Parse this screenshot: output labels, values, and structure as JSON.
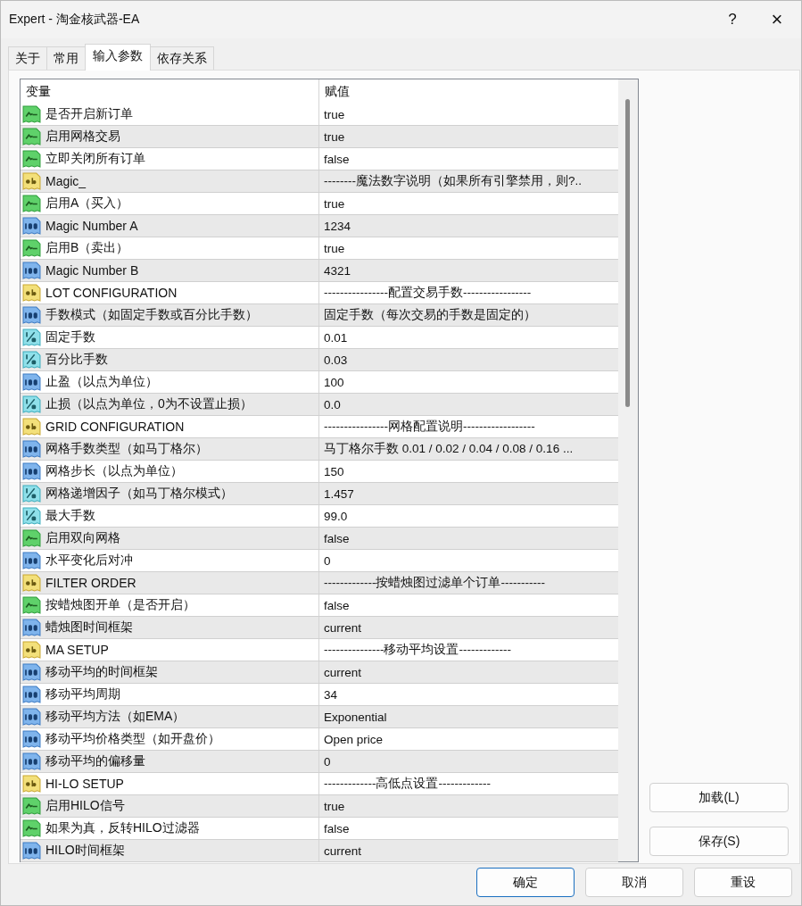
{
  "window": {
    "title": "Expert - 淘金核武器-EA",
    "help": "?",
    "close": "×"
  },
  "tabs": [
    {
      "label": "关于",
      "selected": false
    },
    {
      "label": "常用",
      "selected": false
    },
    {
      "label": "输入参数",
      "selected": true
    },
    {
      "label": "依存关系",
      "selected": false
    }
  ],
  "table": {
    "columns": [
      "变量",
      "赋值"
    ],
    "rows": [
      {
        "kind": "bool",
        "name": "是否开启新订单",
        "value": "true"
      },
      {
        "kind": "bool",
        "name": "启用网格交易",
        "value": "true"
      },
      {
        "kind": "bool",
        "name": "立即关闭所有订单",
        "value": "false"
      },
      {
        "kind": "string",
        "name": "Magic_",
        "value": "--------魔法数字说明（如果所有引擎禁用，则?.."
      },
      {
        "kind": "bool",
        "name": "启用A（买入）",
        "value": "true"
      },
      {
        "kind": "int",
        "name": "Magic Number  A",
        "value": "1234"
      },
      {
        "kind": "bool",
        "name": "启用B（卖出）",
        "value": "true"
      },
      {
        "kind": "int",
        "name": "Magic Number  B",
        "value": "4321"
      },
      {
        "kind": "string",
        "name": "LOT CONFIGURATION",
        "value": "----------------配置交易手数-----------------"
      },
      {
        "kind": "int",
        "name": "手数模式（如固定手数或百分比手数）",
        "value": "固定手数（每次交易的手数是固定的）"
      },
      {
        "kind": "double",
        "name": "固定手数",
        "value": "0.01"
      },
      {
        "kind": "double",
        "name": "百分比手数",
        "value": "0.03"
      },
      {
        "kind": "int",
        "name": "止盈（以点为单位）",
        "value": "100"
      },
      {
        "kind": "double",
        "name": "止损（以点为单位，0为不设置止损）",
        "value": "0.0"
      },
      {
        "kind": "string",
        "name": "GRID CONFIGURATION",
        "value": "----------------网格配置说明------------------"
      },
      {
        "kind": "int",
        "name": "网格手数类型（如马丁格尔）",
        "value": "马丁格尔手数  0.01 / 0.02 / 0.04 / 0.08 / 0.16 ..."
      },
      {
        "kind": "int",
        "name": "网格步长（以点为单位）",
        "value": "150"
      },
      {
        "kind": "double",
        "name": "网格递增因子（如马丁格尔模式）",
        "value": "1.457"
      },
      {
        "kind": "double",
        "name": "最大手数",
        "value": "99.0"
      },
      {
        "kind": "bool",
        "name": "启用双向网格",
        "value": "false"
      },
      {
        "kind": "int",
        "name": "水平变化后对冲",
        "value": "0"
      },
      {
        "kind": "string",
        "name": "FILTER ORDER",
        "value": "-------------按蜡烛图过滤单个订单-----------"
      },
      {
        "kind": "bool",
        "name": "按蜡烛图开单（是否开启）",
        "value": "false"
      },
      {
        "kind": "int",
        "name": "蜡烛图时间框架",
        "value": "current"
      },
      {
        "kind": "string",
        "name": "MA SETUP",
        "value": "---------------移动平均设置-------------"
      },
      {
        "kind": "int",
        "name": "移动平均的时间框架",
        "value": "current"
      },
      {
        "kind": "int",
        "name": "移动平均周期",
        "value": "34"
      },
      {
        "kind": "int",
        "name": "移动平均方法（如EMA）",
        "value": "Exponential"
      },
      {
        "kind": "int",
        "name": "移动平均价格类型（如开盘价）",
        "value": "Open price"
      },
      {
        "kind": "int",
        "name": "移动平均的偏移量",
        "value": "0"
      },
      {
        "kind": "string",
        "name": "HI-LO SETUP",
        "value": "-------------高低点设置-------------"
      },
      {
        "kind": "bool",
        "name": "启用HILO信号",
        "value": "true"
      },
      {
        "kind": "bool",
        "name": "如果为真，反转HILO过滤器",
        "value": "false"
      },
      {
        "kind": "int",
        "name": "HILO时间框架",
        "value": "current"
      }
    ]
  },
  "side_buttons": [
    "加载(L)",
    "保存(S)"
  ],
  "buttons": [
    {
      "label": "确定",
      "default": true
    },
    {
      "label": "取消",
      "default": false
    },
    {
      "label": "重设",
      "default": false
    }
  ]
}
